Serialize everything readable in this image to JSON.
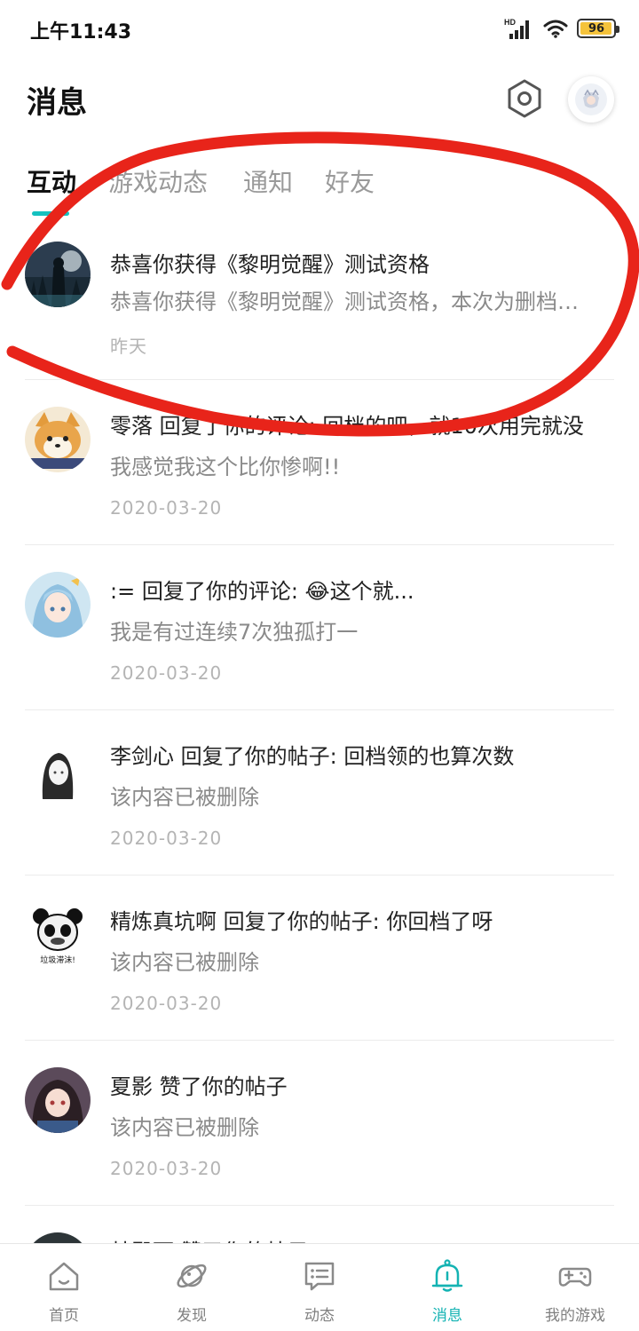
{
  "status_bar": {
    "time": "上午11:43",
    "network": "HD",
    "battery": "96",
    "battery_level": 0.96
  },
  "header": {
    "title": "消息",
    "settings_icon": "hexagon-settings-icon",
    "avatar_icon": "profile-avatar"
  },
  "tabs": [
    {
      "label": "互动",
      "active": true
    },
    {
      "label": "游戏动态",
      "active": false
    },
    {
      "label": "通知",
      "active": false
    },
    {
      "label": "好友",
      "active": false
    }
  ],
  "messages": [
    {
      "title": "恭喜你获得《黎明觉醒》测试资格",
      "subtitle": "恭喜你获得《黎明觉醒》测试资格，本次为删档…",
      "date": "昨天",
      "avatar": "game-forest-avatar"
    },
    {
      "title": "零落 回复了你的评论: 回档的吧，就10次用完就没",
      "subtitle": "我感觉我这个比你惨啊!!",
      "date": "2020-03-20",
      "avatar": "shiba-dog-avatar"
    },
    {
      "title": ":= 回复了你的评论: 😂这个就...",
      "subtitle": "我是有过连续7次独孤打一",
      "date": "2020-03-20",
      "avatar": "anime-girl-blue-avatar"
    },
    {
      "title": "李剑心 回复了你的帖子: 回档领的也算次数",
      "subtitle": "该内容已被删除",
      "date": "2020-03-20",
      "avatar": "sketch-girl-avatar"
    },
    {
      "title": "精炼真坑啊 回复了你的帖子: 你回档了呀",
      "subtitle": "该内容已被删除",
      "date": "2020-03-20",
      "avatar": "panda-meme-avatar",
      "avatar_caption": "垃圾滞沫!"
    },
    {
      "title": "夏影 赞了你的帖子",
      "subtitle": "该内容已被删除",
      "date": "2020-03-20",
      "avatar": "anime-girl-dark-avatar"
    },
    {
      "title": "林殿雨 赞了你的帖子",
      "subtitle": "",
      "date": "",
      "avatar": "dark-avatar"
    }
  ],
  "bottom_nav": [
    {
      "label": "首页",
      "icon": "home-icon",
      "active": false
    },
    {
      "label": "发现",
      "icon": "planet-icon",
      "active": false
    },
    {
      "label": "动态",
      "icon": "message-box-icon",
      "active": false
    },
    {
      "label": "消息",
      "icon": "bell-icon",
      "active": true
    },
    {
      "label": "我的游戏",
      "icon": "gamepad-icon",
      "active": false
    }
  ],
  "colors": {
    "accent": "#14c1c0",
    "annotation": "#e8241a",
    "battery": "#f5c33b"
  }
}
